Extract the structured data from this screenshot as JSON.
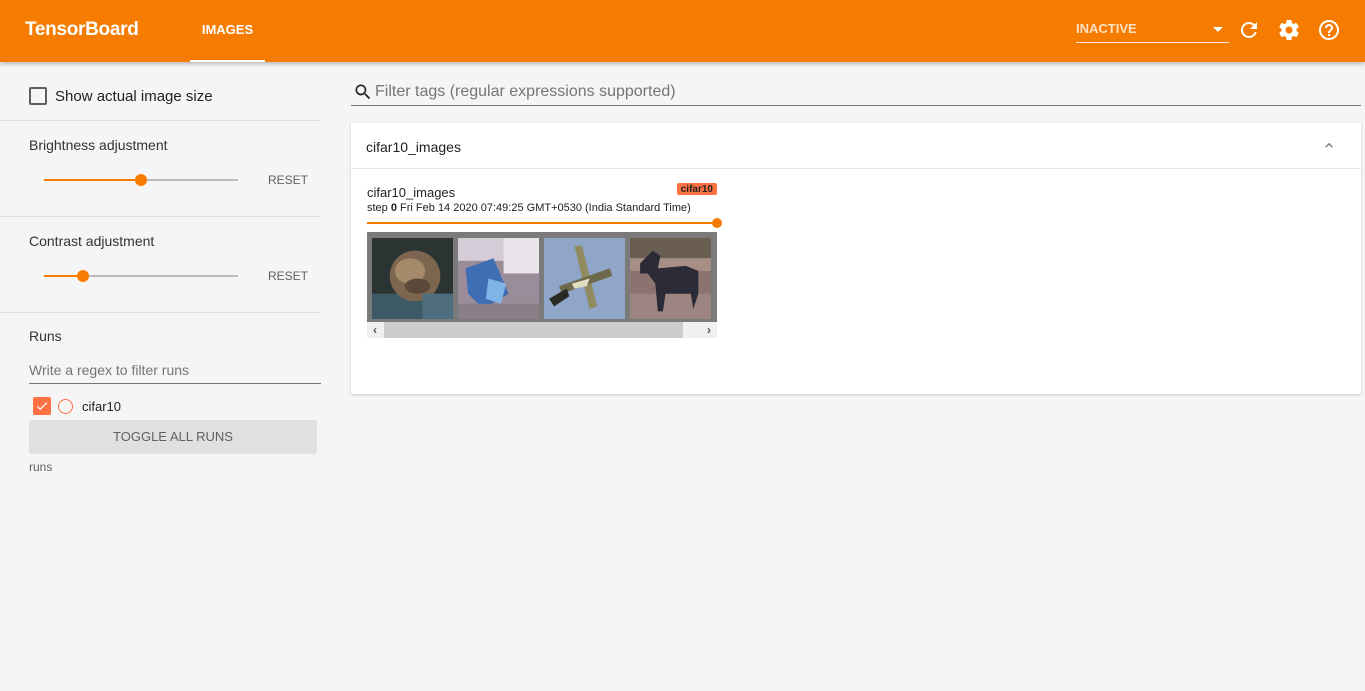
{
  "header": {
    "brand": "TensorBoard",
    "active_tab": "IMAGES",
    "reload_status": "INACTIVE",
    "icons": [
      "refresh-icon",
      "settings-gear-icon",
      "help-icon"
    ],
    "accent_color": "#f57c00"
  },
  "sidebar": {
    "show_actual_size": {
      "label": "Show actual image size",
      "checked": false
    },
    "brightness": {
      "title": "Brightness adjustment",
      "value_fraction": 0.5,
      "reset_label": "RESET"
    },
    "contrast": {
      "title": "Contrast adjustment",
      "value_fraction": 0.2,
      "reset_label": "RESET"
    },
    "runs": {
      "title": "Runs",
      "filter_placeholder": "Write a regex to filter runs",
      "items": [
        {
          "name": "cifar10",
          "checked": true,
          "color": "#ff7043"
        }
      ],
      "toggle_all_label": "TOGGLE ALL RUNS",
      "footer": "runs"
    }
  },
  "main": {
    "filter_placeholder": "Filter tags (regular expressions supported)",
    "categories": [
      {
        "title": "cifar10_images",
        "expanded": true,
        "cards": [
          {
            "tag": "cifar10_images",
            "run": "cifar10",
            "step_label": "step",
            "step": "0",
            "timestamp": "Fri Feb 14 2020 07:49:25 GMT+0530 (India Standard Time)",
            "step_slider_fraction": 1.0,
            "images": [
              "monkey",
              "truck",
              "airplane",
              "horse"
            ]
          }
        ]
      }
    ]
  }
}
